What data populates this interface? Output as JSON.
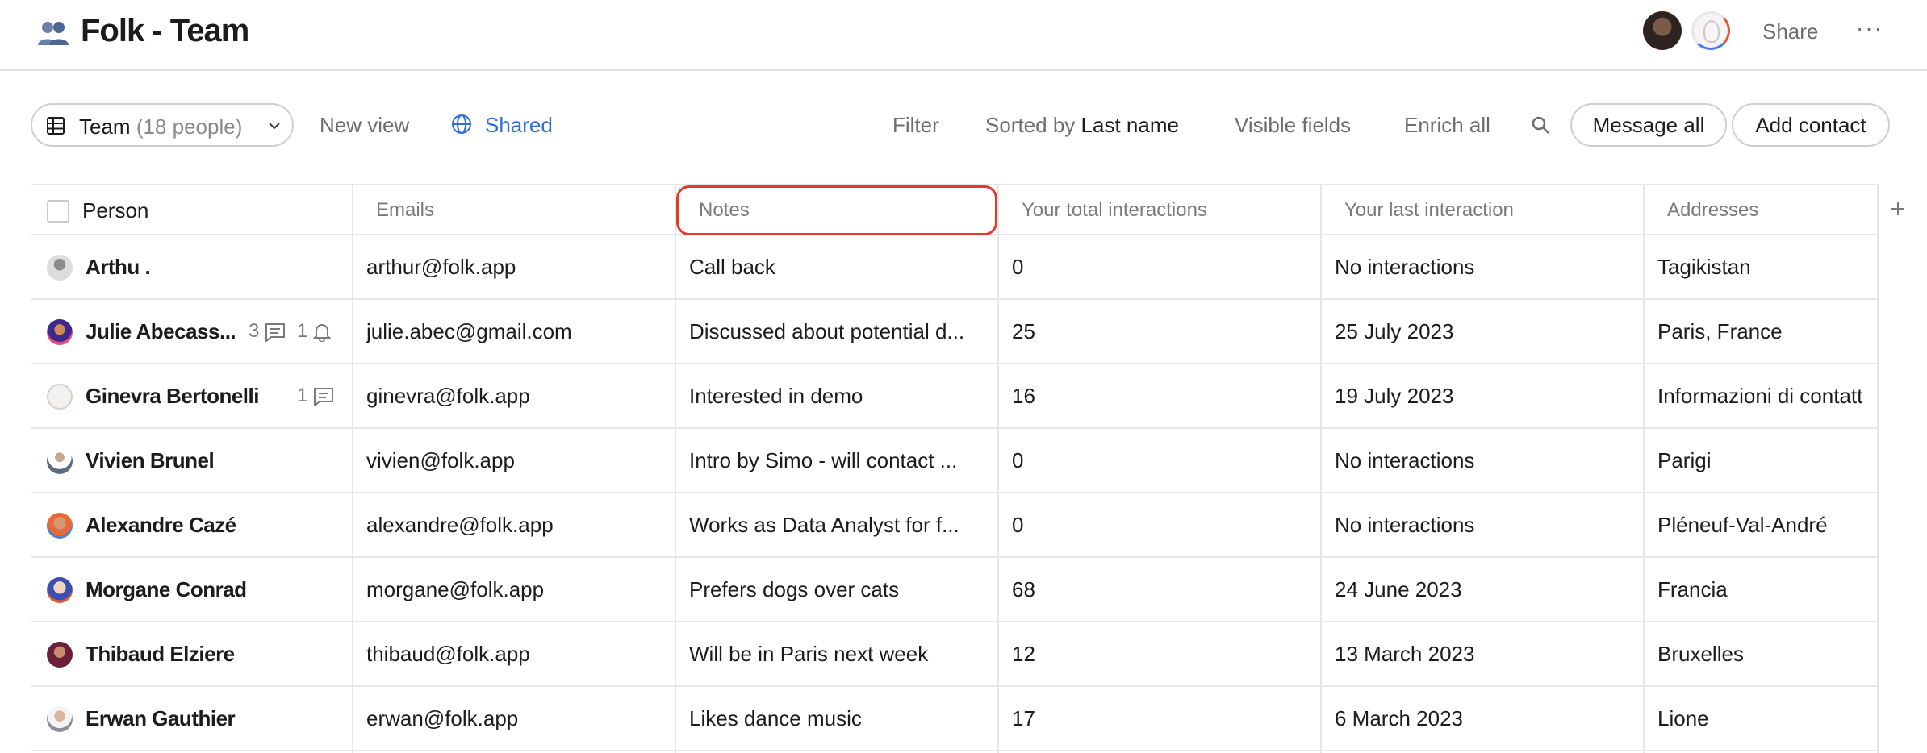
{
  "header": {
    "title": "Folk - Team",
    "share_label": "Share",
    "more_label": "···"
  },
  "toolbar": {
    "view_name": "Team",
    "view_count": "(18 people)",
    "new_view": "New view",
    "shared": "Shared",
    "filter": "Filter",
    "sorted_prefix": "Sorted by",
    "sorted_value": "Last name",
    "visible_fields": "Visible fields",
    "enrich_all": "Enrich all",
    "message_all": "Message all",
    "add_contact": "Add contact"
  },
  "table": {
    "columns": [
      "Person",
      "Emails",
      "Notes",
      "Your total interactions",
      "Your last interaction",
      "Addresses"
    ],
    "rows": [
      {
        "name": "Arthu .",
        "email": "arthur@folk.app",
        "notes": "Call back",
        "total": "0",
        "last": "No interactions",
        "address": "Tagikistan",
        "comments": "",
        "reminders": ""
      },
      {
        "name": "Julie Abecass...",
        "email": "julie.abec@gmail.com",
        "notes": "Discussed about potential d...",
        "total": "25",
        "last": "25 July 2023",
        "address": "Paris, France",
        "comments": "3",
        "reminders": "1"
      },
      {
        "name": "Ginevra Bertonelli",
        "email": "ginevra@folk.app",
        "notes": "Interested in demo",
        "total": "16",
        "last": "19 July 2023",
        "address": "Informazioni di contatt",
        "comments": "1",
        "reminders": ""
      },
      {
        "name": "Vivien Brunel",
        "email": "vivien@folk.app",
        "notes": "Intro by Simo - will contact ...",
        "total": "0",
        "last": "No interactions",
        "address": "Parigi",
        "comments": "",
        "reminders": ""
      },
      {
        "name": "Alexandre Cazé",
        "email": "alexandre@folk.app",
        "notes": "Works as Data Analyst for f...",
        "total": "0",
        "last": "No interactions",
        "address": "Pléneuf-Val-André",
        "comments": "",
        "reminders": ""
      },
      {
        "name": "Morgane Conrad",
        "email": "morgane@folk.app",
        "notes": "Prefers dogs over cats",
        "total": "68",
        "last": "24 June 2023",
        "address": "Francia",
        "comments": "",
        "reminders": ""
      },
      {
        "name": "Thibaud Elziere",
        "email": "thibaud@folk.app",
        "notes": "Will be in Paris next week",
        "total": "12",
        "last": "13 March 2023",
        "address": "Bruxelles",
        "comments": "",
        "reminders": ""
      },
      {
        "name": "Erwan Gauthier",
        "email": "erwan@folk.app",
        "notes": "Likes dance music",
        "total": "17",
        "last": "6 March 2023",
        "address": "Lione",
        "comments": "",
        "reminders": ""
      }
    ]
  },
  "colors": {
    "accent_blue": "#2f6fd6",
    "highlight_red": "#e03b2b"
  },
  "icons": {
    "title": "people-emoji-icon",
    "view": "table-grid-icon",
    "shared": "globe-icon",
    "search": "search-icon",
    "add_column": "plus-icon"
  }
}
